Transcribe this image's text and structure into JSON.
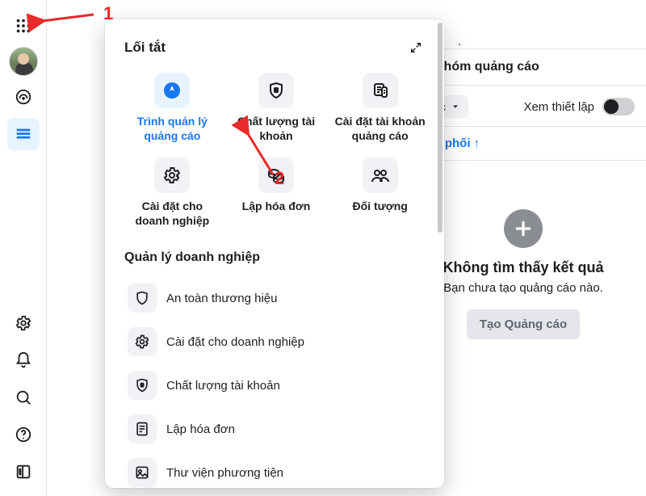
{
  "annotations": {
    "label1": "1",
    "label2": "2"
  },
  "dot": ".",
  "popover": {
    "title": "Lối tắt",
    "shortcuts": [
      {
        "label": "Trình quản lý quảng cáo",
        "icon": "compass",
        "active": true
      },
      {
        "label": "Chất lượng tài khoản",
        "icon": "shield-tag"
      },
      {
        "label": "Cài đặt tài khoản quảng cáo",
        "icon": "doc-list"
      },
      {
        "label": "Cài đặt cho doanh nghiệp",
        "icon": "gear"
      },
      {
        "label": "Lập hóa đơn",
        "icon": "coins"
      },
      {
        "label": "Đối tượng",
        "icon": "people"
      }
    ],
    "sectionTitle": "Quản lý doanh nghiệp",
    "list": [
      {
        "label": "An toàn thương hiệu",
        "icon": "shield"
      },
      {
        "label": "Cài đặt cho doanh nghiệp",
        "icon": "gear"
      },
      {
        "label": "Chất lượng tài khoản",
        "icon": "shield-tag"
      },
      {
        "label": "Lập hóa đơn",
        "icon": "invoice"
      },
      {
        "label": "Thư viện phương tiện",
        "icon": "image"
      }
    ]
  },
  "right": {
    "sectionTitle": "Nhóm quảng cáo",
    "filterLabel": "Khác",
    "viewLabel": "Xem thiết lập",
    "columnLabel": "Phân phối",
    "emptyTitle": "Không tìm thấy kết quả",
    "emptySub": "Bạn chưa tạo quảng cáo nào.",
    "ctaLabel": "Tạo Quảng cáo"
  }
}
